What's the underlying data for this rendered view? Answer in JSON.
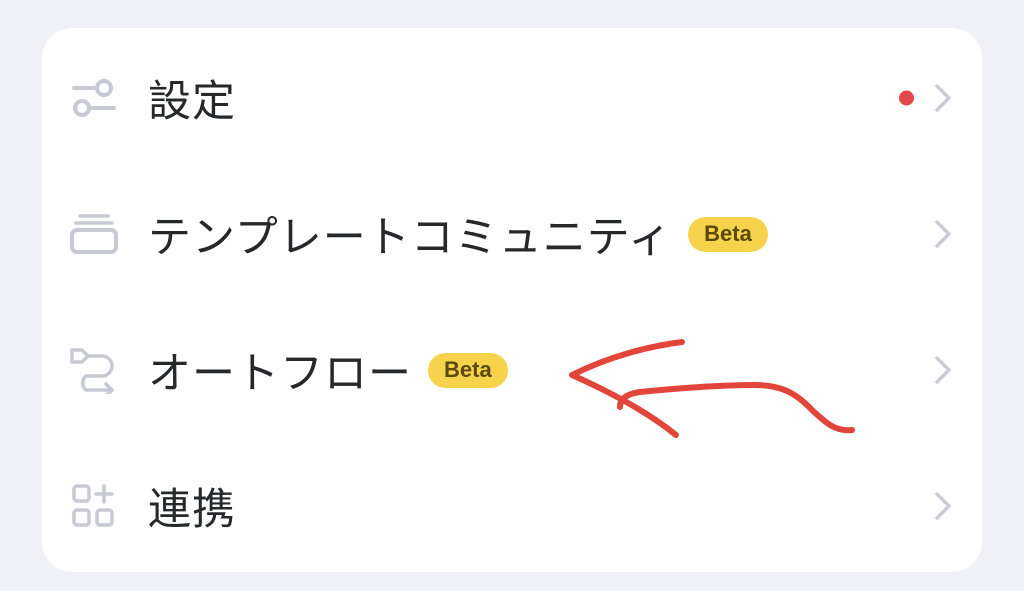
{
  "colors": {
    "background": "#f0f1f6",
    "card": "#ffffff",
    "text": "#26282c",
    "icon": "#c7cad2",
    "chevron": "#c9ccd3",
    "badge_bg": "#f6d24d",
    "notification_dot": "#e0484c",
    "annotation_arrow": "#e2453a"
  },
  "menu": {
    "items": [
      {
        "label": "設定",
        "icon": "toggle-settings-icon",
        "has_notification_dot": true
      },
      {
        "label": "テンプレートコミュニティ",
        "icon": "template-stack-icon",
        "badge": "Beta"
      },
      {
        "label": "オートフロー",
        "icon": "autoflow-icon",
        "badge": "Beta"
      },
      {
        "label": "連携",
        "icon": "integration-grid-icon"
      }
    ]
  }
}
